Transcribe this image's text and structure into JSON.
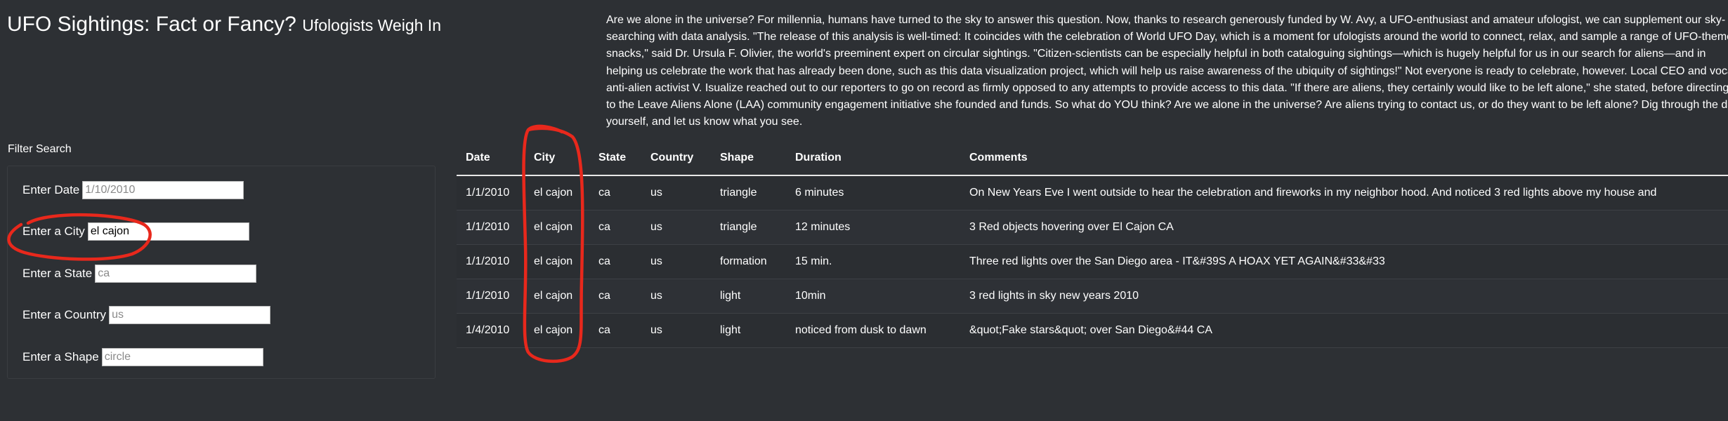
{
  "header": {
    "title": "UFO Sightings: Fact or Fancy?",
    "subtitle": "Ufologists Weigh In"
  },
  "intro": {
    "text": "Are we alone in the universe? For millennia, humans have turned to the sky to answer this question. Now, thanks to research generously funded by W. Avy, a UFO-enthusiast and amateur ufologist, we can supplement our sky-searching with data analysis. \"The release of this analysis is well-timed: It coincides with the celebration of World UFO Day, which is a moment for ufologists around the world to connect, relax, and sample a range of UFO-themed snacks,\" said Dr. Ursula F. Olivier, the world's preeminent expert on circular sightings. \"Citizen-scientists can be especially helpful in both cataloguing sightings—which is hugely helpful for us in our search for aliens—and in helping us celebrate the work that has already been done, such as this data visualization project, which will help us raise awareness of the ubiquity of sightings!\" Not everyone is ready to celebrate, however. Local CEO and vocal anti-alien activist V. Isualize reached out to our reporters to go on record as firmly opposed to any attempts to provide access to this data. \"If there are aliens, they certainly would like to be left alone,\" she stated, before directing us to the Leave Aliens Alone (LAA) community engagement initiative she founded and funds. So what do YOU think? Are we alone in the universe? Are aliens trying to contact us, or do they want to be left alone? Dig through the data yourself, and let us know what you see."
  },
  "filters": {
    "heading": "Filter Search",
    "date": {
      "label": "Enter Date",
      "value": "",
      "placeholder": "1/10/2010"
    },
    "city": {
      "label": "Enter a City",
      "value": "el cajon",
      "placeholder": ""
    },
    "state": {
      "label": "Enter a State",
      "value": "",
      "placeholder": "ca"
    },
    "country": {
      "label": "Enter a Country",
      "value": "",
      "placeholder": "us"
    },
    "shape": {
      "label": "Enter a Shape",
      "value": "",
      "placeholder": "circle"
    }
  },
  "table": {
    "columns": [
      "Date",
      "City",
      "State",
      "Country",
      "Shape",
      "Duration",
      "Comments"
    ],
    "rows": [
      [
        "1/1/2010",
        "el cajon",
        "ca",
        "us",
        "triangle",
        "6 minutes",
        "On New Years Eve I went outside to hear the celebration and fireworks in my neighbor hood. And noticed 3 red lights above my house and"
      ],
      [
        "1/1/2010",
        "el cajon",
        "ca",
        "us",
        "triangle",
        "12 minutes",
        "3 Red objects hovering over El Cajon CA"
      ],
      [
        "1/1/2010",
        "el cajon",
        "ca",
        "us",
        "formation",
        "15 min.",
        "Three red lights over the San Diego area - IT&#39S A HOAX YET AGAIN&#33&#33"
      ],
      [
        "1/1/2010",
        "el cajon",
        "ca",
        "us",
        "light",
        "10min",
        "3 red lights in sky new years 2010"
      ],
      [
        "1/4/2010",
        "el cajon",
        "ca",
        "us",
        "light",
        "noticed from dusk to dawn",
        "&quot;Fake stars&quot; over San Diego&#44 CA"
      ]
    ]
  },
  "colors": {
    "background": "#2d3034",
    "text": "#ffffff",
    "annotation": "#e8281c"
  }
}
